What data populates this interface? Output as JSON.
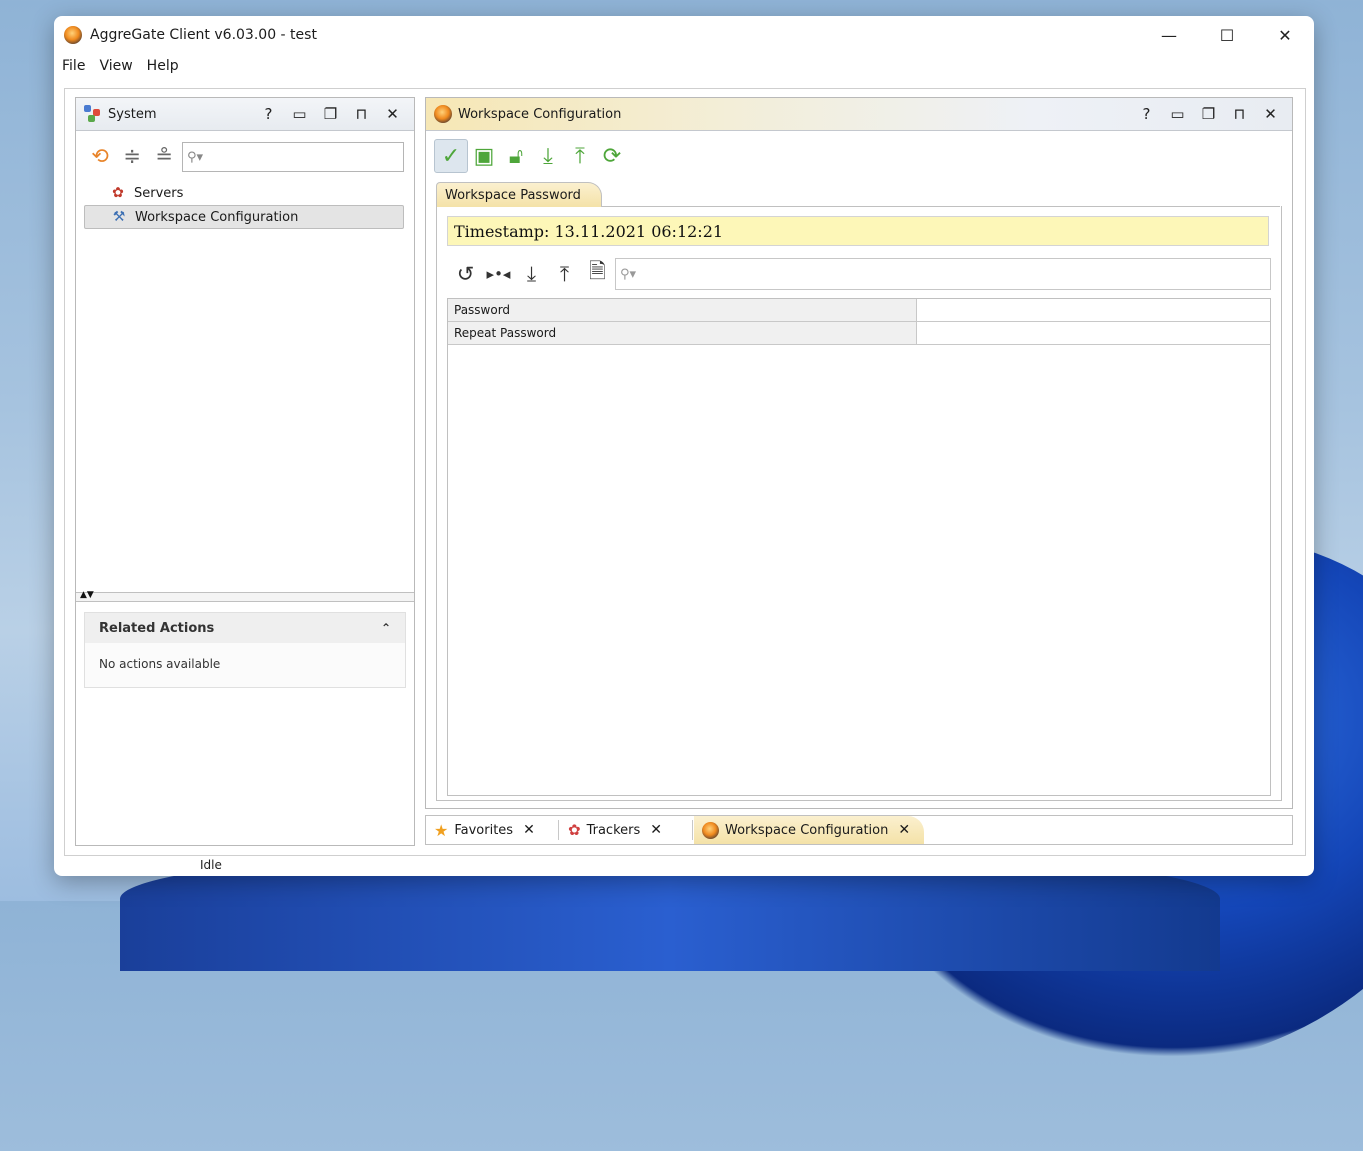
{
  "window": {
    "title": "AggreGate Client v6.03.00 - test",
    "minimize_glyph": "—",
    "maximize_glyph": "☐",
    "close_glyph": "✕"
  },
  "menu": [
    "File",
    "View",
    "Help"
  ],
  "left_panel": {
    "title": "System",
    "header_icons": [
      "help-icon",
      "maximize-icon",
      "restore-icon",
      "pin-icon",
      "close-icon"
    ],
    "toolbar_icons": [
      "refresh-icon",
      "expand-all-icon",
      "collapse-all-icon"
    ],
    "search_placeholder": "",
    "tree": [
      {
        "label": "Servers",
        "icon": "servers-icon"
      },
      {
        "label": "Workspace Configuration",
        "icon": "tools-icon",
        "selected": true
      }
    ],
    "related_actions": {
      "title": "Related Actions",
      "body": "No actions available"
    }
  },
  "right_panel": {
    "title": "Workspace Configuration",
    "toolbar_icons": [
      "save-check-icon",
      "window-icon",
      "unlock-icon",
      "download-icon",
      "upload-icon",
      "refresh-icon"
    ],
    "tab_label": "Workspace Password",
    "timestamp": "Timestamp: 13.11.2021 06:12:21",
    "inner_toolbar_icons": [
      "reload-icon",
      "compare-icon",
      "import-icon",
      "export-icon",
      "document-icon"
    ],
    "search_placeholder": "",
    "properties": [
      {
        "name": "Password",
        "value": ""
      },
      {
        "name": "Repeat Password",
        "value": ""
      }
    ]
  },
  "bottom_tabs": [
    {
      "label": "Favorites",
      "icon": "star-icon",
      "selected": false
    },
    {
      "label": "Trackers",
      "icon": "trackers-icon",
      "selected": false
    },
    {
      "label": "Workspace Configuration",
      "icon": "aggregate-icon",
      "selected": true
    }
  ],
  "status": "Idle",
  "colors": {
    "accent_green": "#4ea63a",
    "timestamp_bg": "#fdf7b8",
    "tab_selected_bg": "#f4e2a8"
  }
}
